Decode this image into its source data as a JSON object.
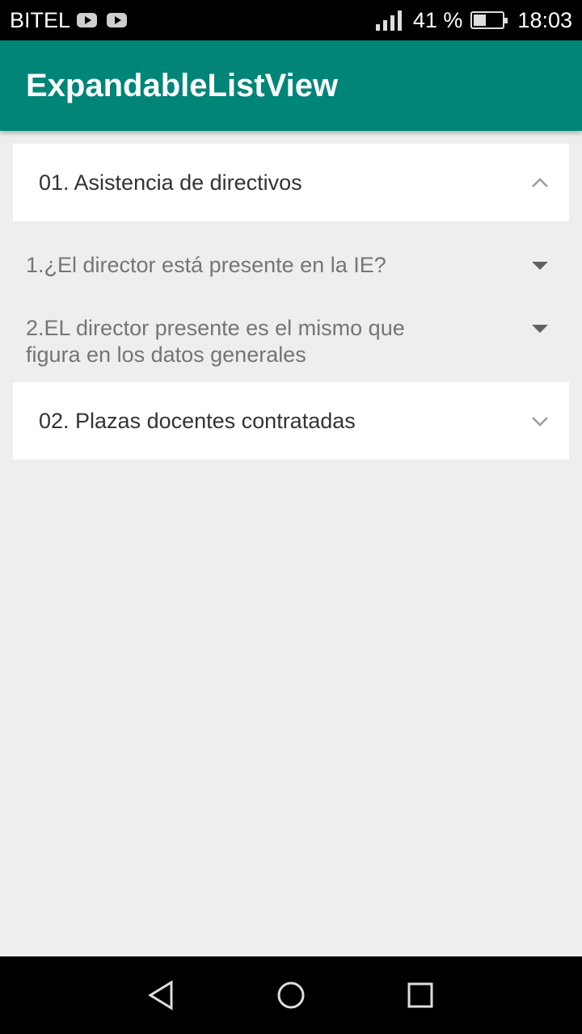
{
  "status_bar": {
    "carrier": "BITEL",
    "battery_percent": "41 %",
    "time": "18:03",
    "signal_level": 4,
    "battery_level": 0.41
  },
  "app_bar": {
    "title": "ExpandableListView",
    "color": "#008577"
  },
  "list": {
    "groups": [
      {
        "label": "01. Asistencia de directivos",
        "expanded": true,
        "icon": "chevron-up-icon",
        "children": [
          {
            "label": "1.¿El director está presente en la IE?",
            "icon": "dropdown-arrow-icon"
          },
          {
            "label": "2.EL director presente es el mismo que figura en los datos generales",
            "icon": "dropdown-arrow-icon"
          }
        ]
      },
      {
        "label": "02. Plazas docentes contratadas",
        "expanded": false,
        "icon": "chevron-down-icon"
      }
    ]
  },
  "nav_bar": {
    "buttons": [
      "back-icon",
      "home-icon",
      "recents-icon"
    ]
  }
}
